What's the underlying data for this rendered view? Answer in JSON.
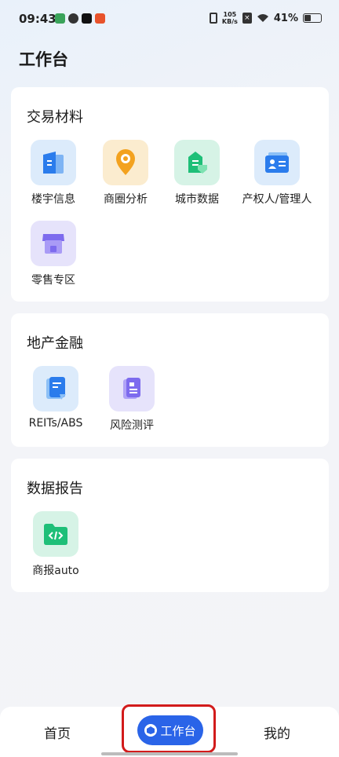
{
  "status_bar": {
    "time": "09:43",
    "net_speed_value": "105",
    "net_speed_unit": "KB/s",
    "battery": "41%"
  },
  "page": {
    "title": "工作台"
  },
  "sections": [
    {
      "title": "交易材料",
      "items": [
        {
          "label": "楼宇信息",
          "icon": "building-info-icon"
        },
        {
          "label": "商圈分析",
          "icon": "location-pin-icon"
        },
        {
          "label": "城市数据",
          "icon": "city-data-icon"
        },
        {
          "label": "产权人/管理人",
          "icon": "id-card-icon"
        },
        {
          "label": "零售专区",
          "icon": "store-icon"
        }
      ]
    },
    {
      "title": "地产金融",
      "items": [
        {
          "label": "REITs/ABS",
          "icon": "document-icon"
        },
        {
          "label": "风险测评",
          "icon": "report-icon"
        }
      ]
    },
    {
      "title": "数据报告",
      "items": [
        {
          "label": "商报auto",
          "icon": "code-folder-icon"
        }
      ]
    }
  ],
  "bottom_nav": {
    "home": "首页",
    "workbench": "工作台",
    "mine": "我的"
  },
  "colors": {
    "accent": "#2a64e8",
    "highlight": "#d21b1b"
  }
}
